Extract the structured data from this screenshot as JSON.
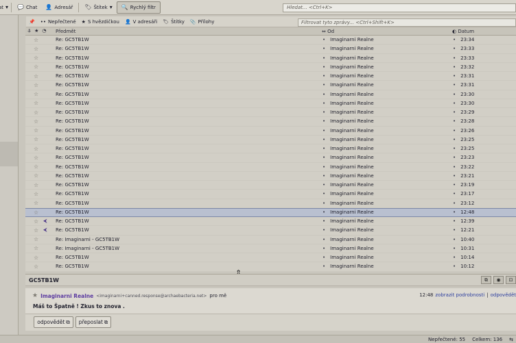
{
  "toolbar": {
    "partial_first": "at",
    "chat": "Chat",
    "addressbook": "Adresář",
    "tag": "Štítek",
    "quickfilter": "Rychlý filtr",
    "search_placeholder": "Hledat... <Ctrl+K>"
  },
  "filterbar": {
    "unread": "Nepřečtené",
    "starred": "S hvězdičkou",
    "contacts": "V adresáři",
    "tags": "Štítky",
    "attachments": "Přílohy",
    "filter_placeholder": "Filtrovat tyto zprávy... <Ctrl+Shift+K>"
  },
  "columns": {
    "subject": "Předmět",
    "from": "Od",
    "date": "Datum"
  },
  "messages": [
    {
      "subject": "Re: GC5TB1W",
      "from": "Imaginarni Realne",
      "date": "23:34",
      "replied": false,
      "selected": false
    },
    {
      "subject": "Re: GC5TB1W",
      "from": "Imaginarni Realne",
      "date": "23:33",
      "replied": false,
      "selected": false
    },
    {
      "subject": "Re: GC5TB1W",
      "from": "Imaginarni Realne",
      "date": "23:33",
      "replied": false,
      "selected": false
    },
    {
      "subject": "Re: GC5TB1W",
      "from": "Imaginarni Realne",
      "date": "23:32",
      "replied": false,
      "selected": false
    },
    {
      "subject": "Re: GC5TB1W",
      "from": "Imaginarni Realne",
      "date": "23:31",
      "replied": false,
      "selected": false
    },
    {
      "subject": "Re: GC5TB1W",
      "from": "Imaginarni Realne",
      "date": "23:31",
      "replied": false,
      "selected": false
    },
    {
      "subject": "Re: GC5TB1W",
      "from": "Imaginarni Realne",
      "date": "23:30",
      "replied": false,
      "selected": false
    },
    {
      "subject": "Re: GC5TB1W",
      "from": "Imaginarni Realne",
      "date": "23:30",
      "replied": false,
      "selected": false
    },
    {
      "subject": "Re: GC5TB1W",
      "from": "Imaginarni Realne",
      "date": "23:29",
      "replied": false,
      "selected": false
    },
    {
      "subject": "Re: GC5TB1W",
      "from": "Imaginarni Realne",
      "date": "23:28",
      "replied": false,
      "selected": false
    },
    {
      "subject": "Re: GC5TB1W",
      "from": "Imaginarni Realne",
      "date": "23:26",
      "replied": false,
      "selected": false
    },
    {
      "subject": "Re: GC5TB1W",
      "from": "Imaginarni Realne",
      "date": "23:25",
      "replied": false,
      "selected": false
    },
    {
      "subject": "Re: GC5TB1W",
      "from": "Imaginarni Realne",
      "date": "23:25",
      "replied": false,
      "selected": false
    },
    {
      "subject": "Re: GC5TB1W",
      "from": "Imaginarni Realne",
      "date": "23:23",
      "replied": false,
      "selected": false
    },
    {
      "subject": "Re: GC5TB1W",
      "from": "Imaginarni Realne",
      "date": "23:22",
      "replied": false,
      "selected": false
    },
    {
      "subject": "Re: GC5TB1W",
      "from": "Imaginarni Realne",
      "date": "23:21",
      "replied": false,
      "selected": false
    },
    {
      "subject": "Re: GC5TB1W",
      "from": "Imaginarni Realne",
      "date": "23:19",
      "replied": false,
      "selected": false
    },
    {
      "subject": "Re: GC5TB1W",
      "from": "Imaginarni Realne",
      "date": "23:17",
      "replied": false,
      "selected": false
    },
    {
      "subject": "Re: GC5TB1W",
      "from": "Imaginarni Realne",
      "date": "23:12",
      "replied": false,
      "selected": false
    },
    {
      "subject": "Re: GC5TB1W",
      "from": "Imaginarni Realne",
      "date": "12:48",
      "replied": false,
      "selected": true
    },
    {
      "subject": "Re: GC5TB1W",
      "from": "Imaginarni Realne",
      "date": "12:39",
      "replied": true,
      "selected": false
    },
    {
      "subject": "Re: GC5TB1W",
      "from": "Imaginarni Realne",
      "date": "12:21",
      "replied": true,
      "selected": false
    },
    {
      "subject": "Re: Imaginarni - GC5TB1W",
      "from": "Imaginarni Realne",
      "date": "10:40",
      "replied": false,
      "selected": false
    },
    {
      "subject": "Re: Imaginarni - GC5TB1W",
      "from": "Imaginarni Realne",
      "date": "10:31",
      "replied": false,
      "selected": false
    },
    {
      "subject": "Re: GC5TB1W",
      "from": "Imaginarni Realne",
      "date": "10:14",
      "replied": false,
      "selected": false
    },
    {
      "subject": "Re: GC5TB1W",
      "from": "Imaginarni Realne",
      "date": "10:12",
      "replied": false,
      "selected": false
    }
  ],
  "preview": {
    "title": "GC5TB1W",
    "sender_name": "Imaginarni Realne",
    "sender_addr": "<imaginarni+canned.response@archaebacteria.net>",
    "to_text": "pro mě",
    "time": "12:48",
    "details_link": "zobrazit podrobnosti",
    "sep": "|",
    "reply_link": "odpovědět",
    "body": "Máš to Špatně ! Zkus to znova .",
    "reply_btn": "odpovědět",
    "forward_btn": "přeposlat"
  },
  "status": {
    "unread": "Nepřečtené: 55",
    "total": "Celkem: 136"
  },
  "colors": {
    "selected_row": "#b9c0d0",
    "sender_name": "#5b3aa0",
    "link": "#2d3f9f"
  }
}
